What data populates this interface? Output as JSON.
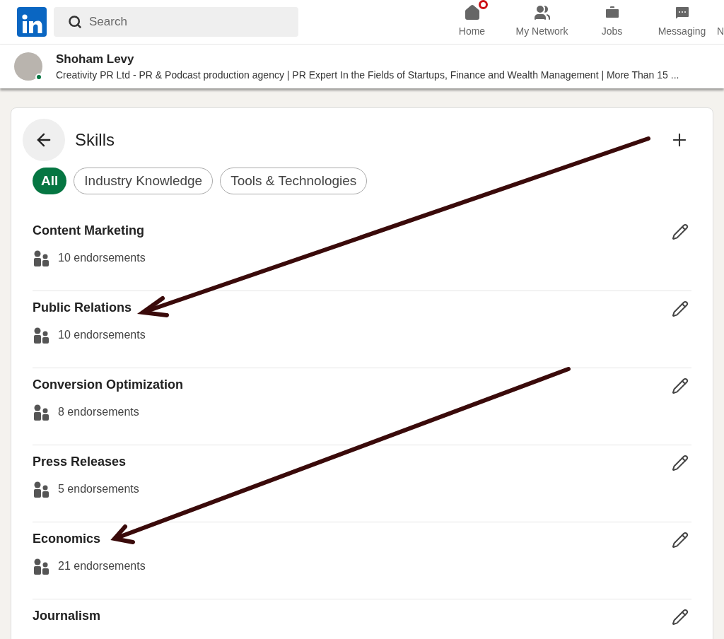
{
  "header": {
    "search": {
      "placeholder": "Search"
    },
    "nav": [
      {
        "kind": "home",
        "label": "Home",
        "badge": true
      },
      {
        "kind": "network",
        "label": "My Network",
        "badge": false
      },
      {
        "kind": "jobs",
        "label": "Jobs",
        "badge": false
      },
      {
        "kind": "messaging",
        "label": "Messaging",
        "badge": false
      },
      {
        "kind": "cut",
        "label": "N",
        "badge": false
      }
    ]
  },
  "profile": {
    "name": "Shoham Levy",
    "online": true,
    "headline": "Creativity PR Ltd - PR & Podcast production agency | PR Expert In the Fields of Startups, Finance and Wealth Management | More Than 15 ..."
  },
  "skills": {
    "title": "Skills",
    "filters": [
      {
        "label": "All",
        "selected": true
      },
      {
        "label": "Industry Knowledge",
        "selected": false
      },
      {
        "label": "Tools & Technologies",
        "selected": false
      }
    ],
    "items": [
      {
        "name": "Content Marketing",
        "endorsements": "10 endorsements"
      },
      {
        "name": "Public Relations",
        "endorsements": "10 endorsements"
      },
      {
        "name": "Conversion Optimization",
        "endorsements": "8 endorsements"
      },
      {
        "name": "Press Releases",
        "endorsements": "5 endorsements"
      },
      {
        "name": "Economics",
        "endorsements": "21 endorsements"
      },
      {
        "name": "Journalism"
      }
    ]
  }
}
